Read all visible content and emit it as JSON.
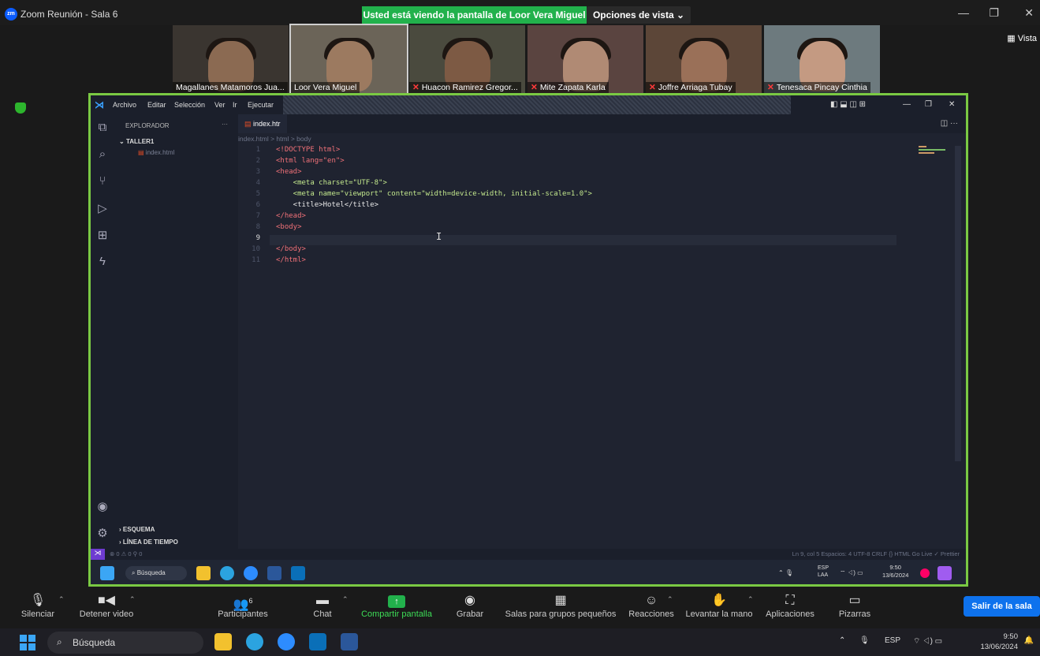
{
  "zoom": {
    "window_title": "Zoom Reunión - Sala 6",
    "logo_text": "zm",
    "share_banner": "Usted está viendo la pantalla de Loor Vera Miguel",
    "view_options": "Opciones de vista",
    "vista": "Vista",
    "participants": [
      {
        "name": "Magallanes Matamoros Jua...",
        "muted": false
      },
      {
        "name": "Loor Vera Miguel",
        "muted": false
      },
      {
        "name": "Huacon Ramirez Gregor...",
        "muted": true
      },
      {
        "name": "Mite Zapata Karla",
        "muted": true
      },
      {
        "name": "Joffre Arriaga Tubay",
        "muted": true
      },
      {
        "name": "Tenesaca Pincay Cinthia",
        "muted": true
      }
    ],
    "toolbar": {
      "mute": "Silenciar",
      "video": "Detener video",
      "participants": "Participantes",
      "participants_count": "6",
      "chat": "Chat",
      "share": "Compartir pantalla",
      "record": "Grabar",
      "breakout": "Salas para grupos pequeños",
      "reactions": "Reacciones",
      "raise_hand": "Levantar la mano",
      "apps": "Aplicaciones",
      "whiteboards": "Pizarras",
      "leave": "Salir de la sala"
    }
  },
  "vscode": {
    "menu": [
      "Archivo",
      "Editar",
      "Selección",
      "Ver",
      "Ir",
      "Ejecutar"
    ],
    "explorer_title": "EXPLORADOR",
    "folder": "TALLER1",
    "file": "index.html",
    "tab": "index.htr",
    "breadcrumb": "index.html > html > body",
    "outline": "ESQUEMA",
    "timeline": "LÍNEA DE TIEMPO",
    "code_lines": [
      "<!DOCTYPE html>",
      "<html lang=\"en\">",
      "<head>",
      "    <meta charset=\"UTF-8\">",
      "    <meta name=\"viewport\" content=\"width=device-width, initial-scale=1.0\">",
      "    <title>Hotel</title>",
      "</head>",
      "<body>",
      "    ",
      "</body>",
      "</html>"
    ],
    "current_line": 9,
    "status": "Ln 9, col 5   Espacios: 4   UTF-8   CRLF   {} HTML   Go Live   ✓ Prettier",
    "status_left": "⊗ 0 ⚠ 0   ⚲ 0",
    "inner_search": "Búsqueda",
    "inner_lang": "ESP\nLAA",
    "inner_time": "9:50",
    "inner_date": "13/6/2024"
  },
  "windows": {
    "search": "Búsqueda",
    "lang": "ESP",
    "time": "9:50",
    "date": "13/06/2024"
  }
}
